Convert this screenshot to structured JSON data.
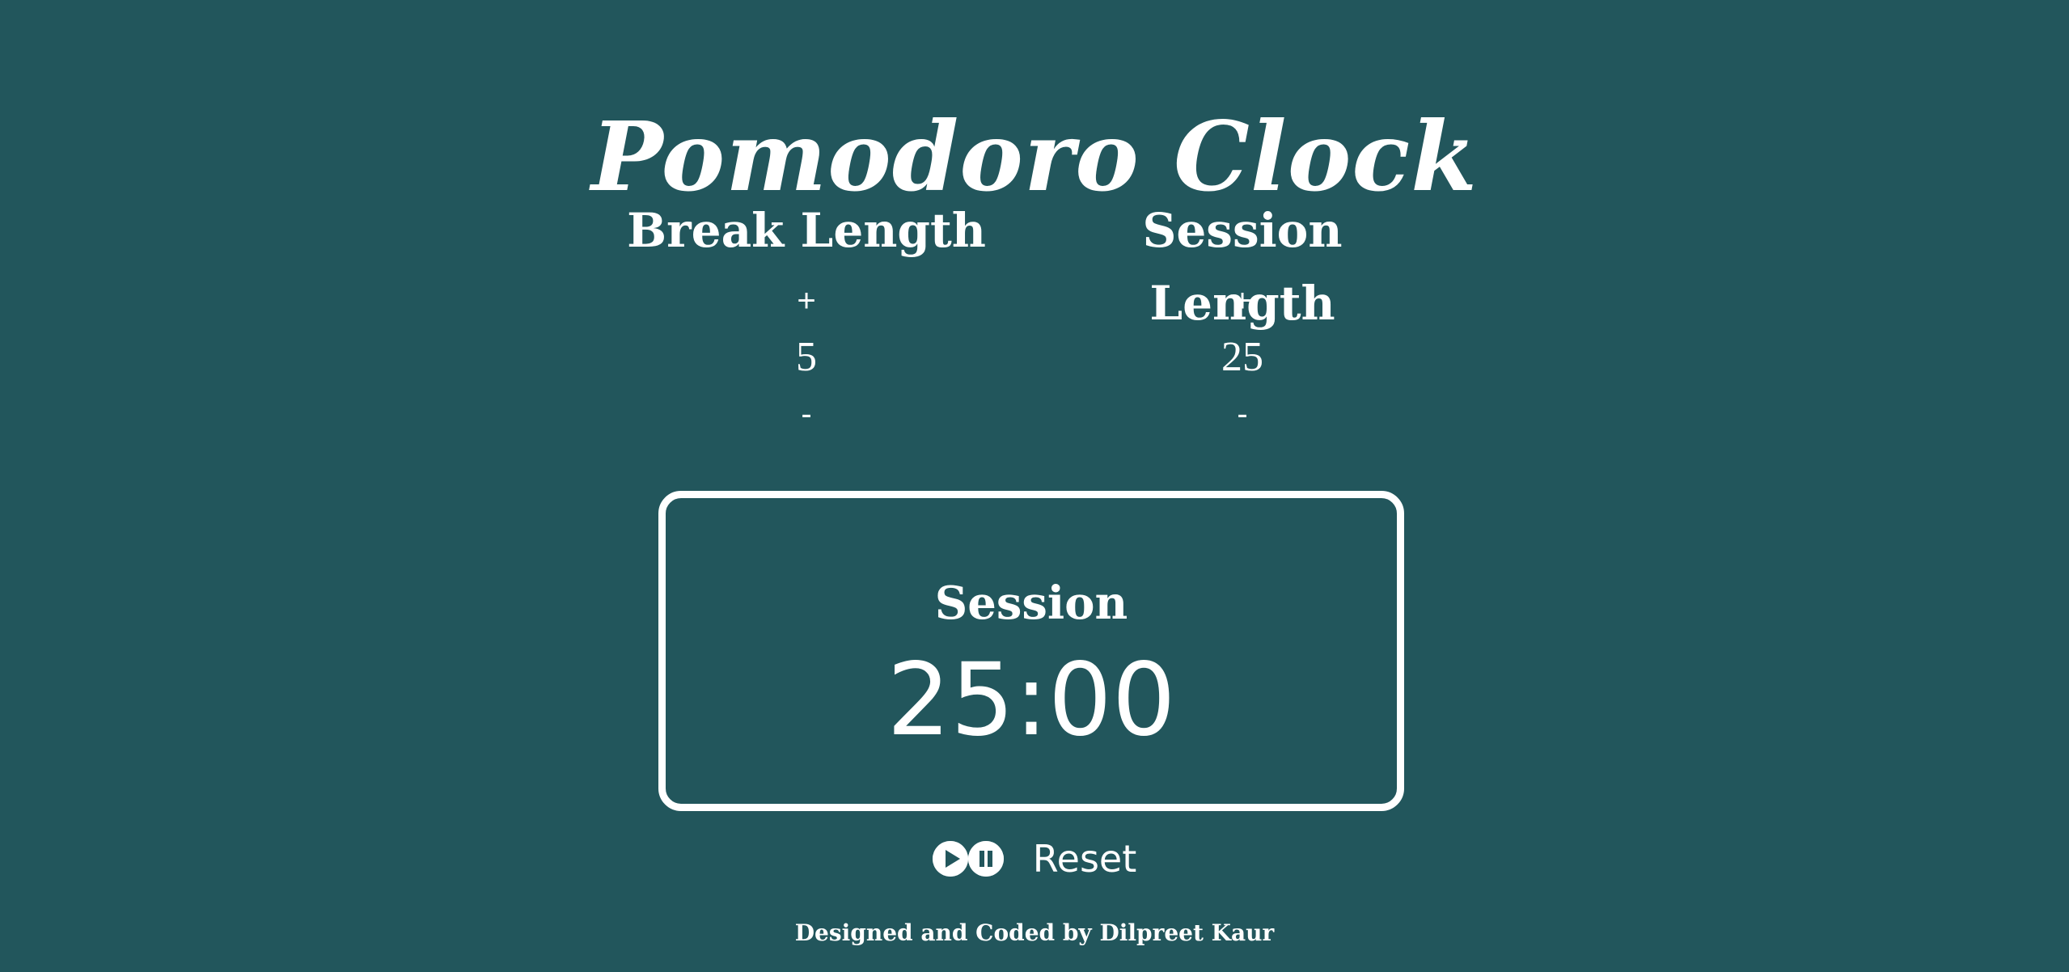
{
  "header": {
    "title": "Pomodoro Clock"
  },
  "break": {
    "label": "Break Length",
    "increment": "+",
    "value": "5",
    "decrement": "-"
  },
  "session": {
    "label": "Session Length",
    "increment": "+",
    "value": "25",
    "decrement": "-"
  },
  "timer": {
    "label": "Session",
    "time": "25:00"
  },
  "controls": {
    "play_icon": "play-circle-icon",
    "pause_icon": "pause-circle-icon",
    "reset_label": "Reset"
  },
  "footer": {
    "credit": "Designed and Coded by Dilpreet Kaur"
  },
  "colors": {
    "background": "#22565c",
    "foreground": "#ffffff"
  }
}
